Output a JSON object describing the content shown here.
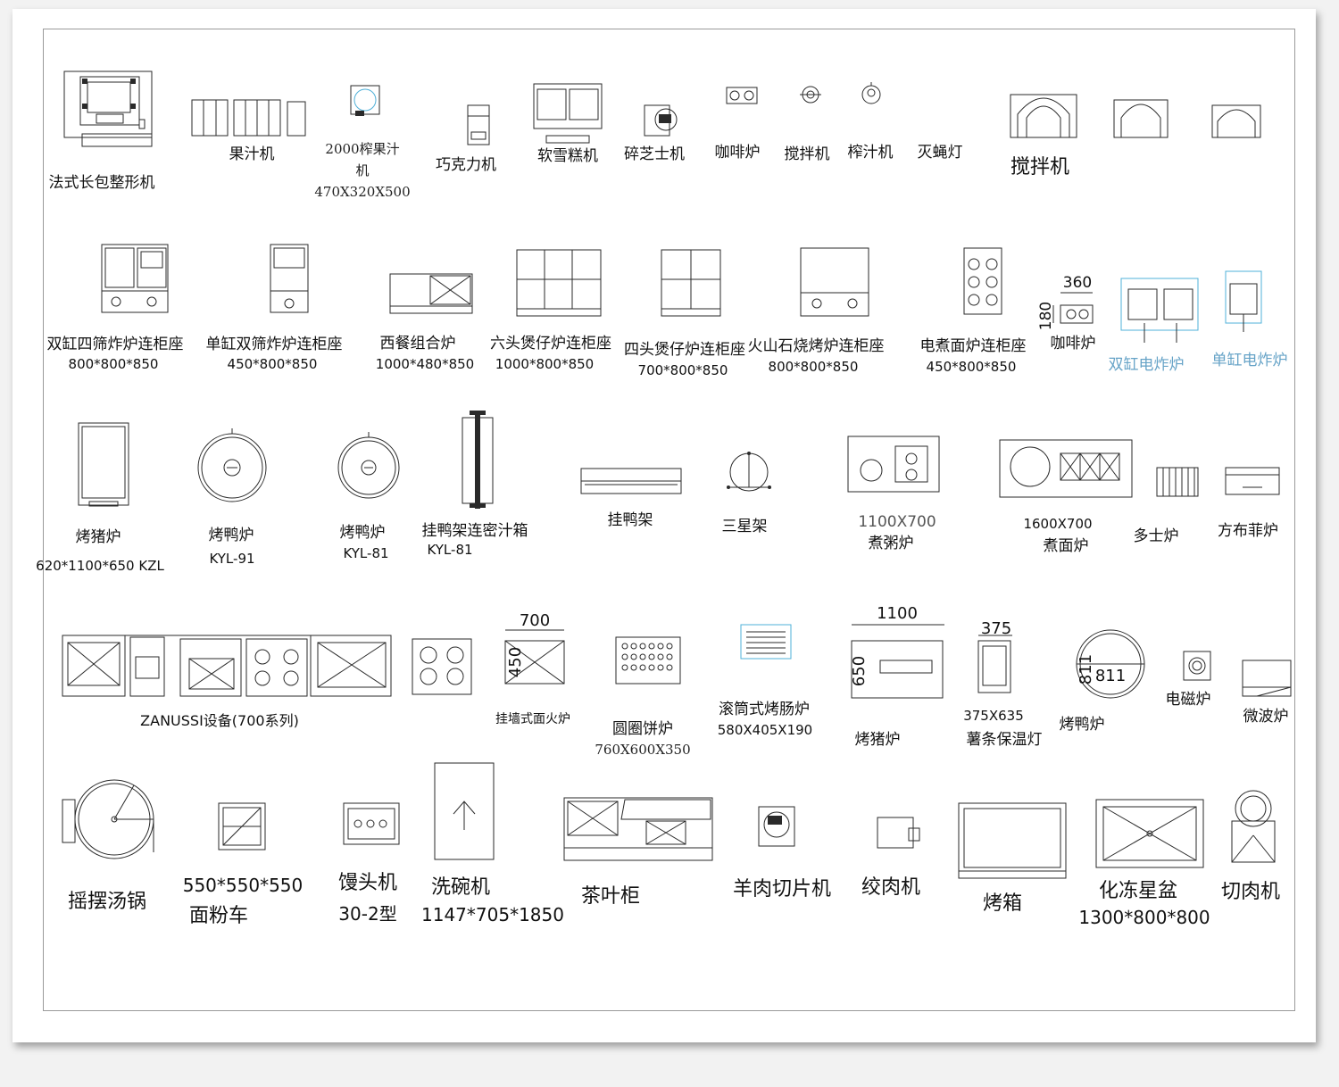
{
  "labels": {
    "baguette_shaper": "法式长包整形机",
    "juicer_set": "果汁机",
    "juicer_2000": "2000榨果汁",
    "juicer_2000_b": "机",
    "juicer_2000_dim": "470X320X500",
    "chocolate": "巧克力机",
    "soft_serve": "软雪糕机",
    "cheese_grater": "碎芝士机",
    "coffee_stove": "咖啡炉",
    "mixer_small": "搅拌机",
    "juicer_small": "榨汁机",
    "fly_lamp": "灭蝇灯",
    "mixer_large": "搅拌机",
    "fryer_double": "双缸四筛炸炉连柜座",
    "fryer_double_dim": "800*800*850",
    "fryer_single": "单缸双筛炸炉连柜座",
    "fryer_single_dim": "450*800*850",
    "western_combo": "西餐组合炉",
    "western_combo_dim": "1000*480*850",
    "six_burner": "六头煲仔炉连柜座",
    "six_burner_dim": "1000*800*850",
    "four_burner": "四头煲仔炉连柜座",
    "four_burner_dim": "700*800*850",
    "lava_grill": "火山石烧烤炉连柜座",
    "lava_grill_dim": "800*800*850",
    "noodle_cooker": "电煮面炉连柜座",
    "noodle_cooker_dim": "450*800*850",
    "coffee_dim_w": "360",
    "coffee_dim_h": "180",
    "coffee_stove2": "咖啡炉",
    "elec_fryer_double": "双缸电炸炉",
    "elec_fryer_single": "单缸电炸炉",
    "pig_roaster": "烤猪炉",
    "pig_roaster_dim": "620*1100*650 KZL",
    "duck_oven1": "烤鸭炉",
    "duck_oven1_model": "KYL-91",
    "duck_oven2": "烤鸭炉",
    "duck_oven2_model": "KYL-81",
    "duck_rack_box": "挂鸭架连密汁箱",
    "duck_rack_box_model": "KYL-81",
    "duck_rack": "挂鸭架",
    "tripod": "三星架",
    "congee_dim": "1100X700",
    "congee": "煮粥炉",
    "noodle_dim": "1600X700",
    "noodle": "煮面炉",
    "toaster": "多士炉",
    "waffle": "方布菲炉",
    "zanussi": "ZANUSSI设备(700系列)",
    "salamander_w": "700",
    "salamander_h": "450",
    "salamander": "挂墙式面火炉",
    "donut": "圆圈饼炉",
    "donut_dim": "760X600X350",
    "sausage": "滚筒式烤肠炉",
    "sausage_dim": "580X405X190",
    "pig2_w": "1100",
    "pig2_h": "650",
    "pig_roaster2": "烤猪炉",
    "fries_w": "375",
    "fries_dim": "375X635",
    "fries_lamp": "薯条保温灯",
    "duck_d1": "811",
    "duck_d2": "811",
    "duck_oven3": "烤鸭炉",
    "induction": "电磁炉",
    "microwave": "微波炉",
    "tilt_kettle": "摇摆汤锅",
    "dough_dim": "550*550*550",
    "dough_cart": "面粉车",
    "steamer": "馒头机",
    "steamer_model": "30-2型",
    "dishwasher": "洗碗机",
    "dishwasher_dim": "1147*705*1850",
    "tea_cabinet": "茶叶柜",
    "mutton_slicer": "羊肉切片机",
    "mincer": "绞肉机",
    "oven": "烤箱",
    "thaw_sink": "化冻星盆",
    "thaw_sink_dim": "1300*800*800",
    "meat_slicer": "切肉机"
  }
}
